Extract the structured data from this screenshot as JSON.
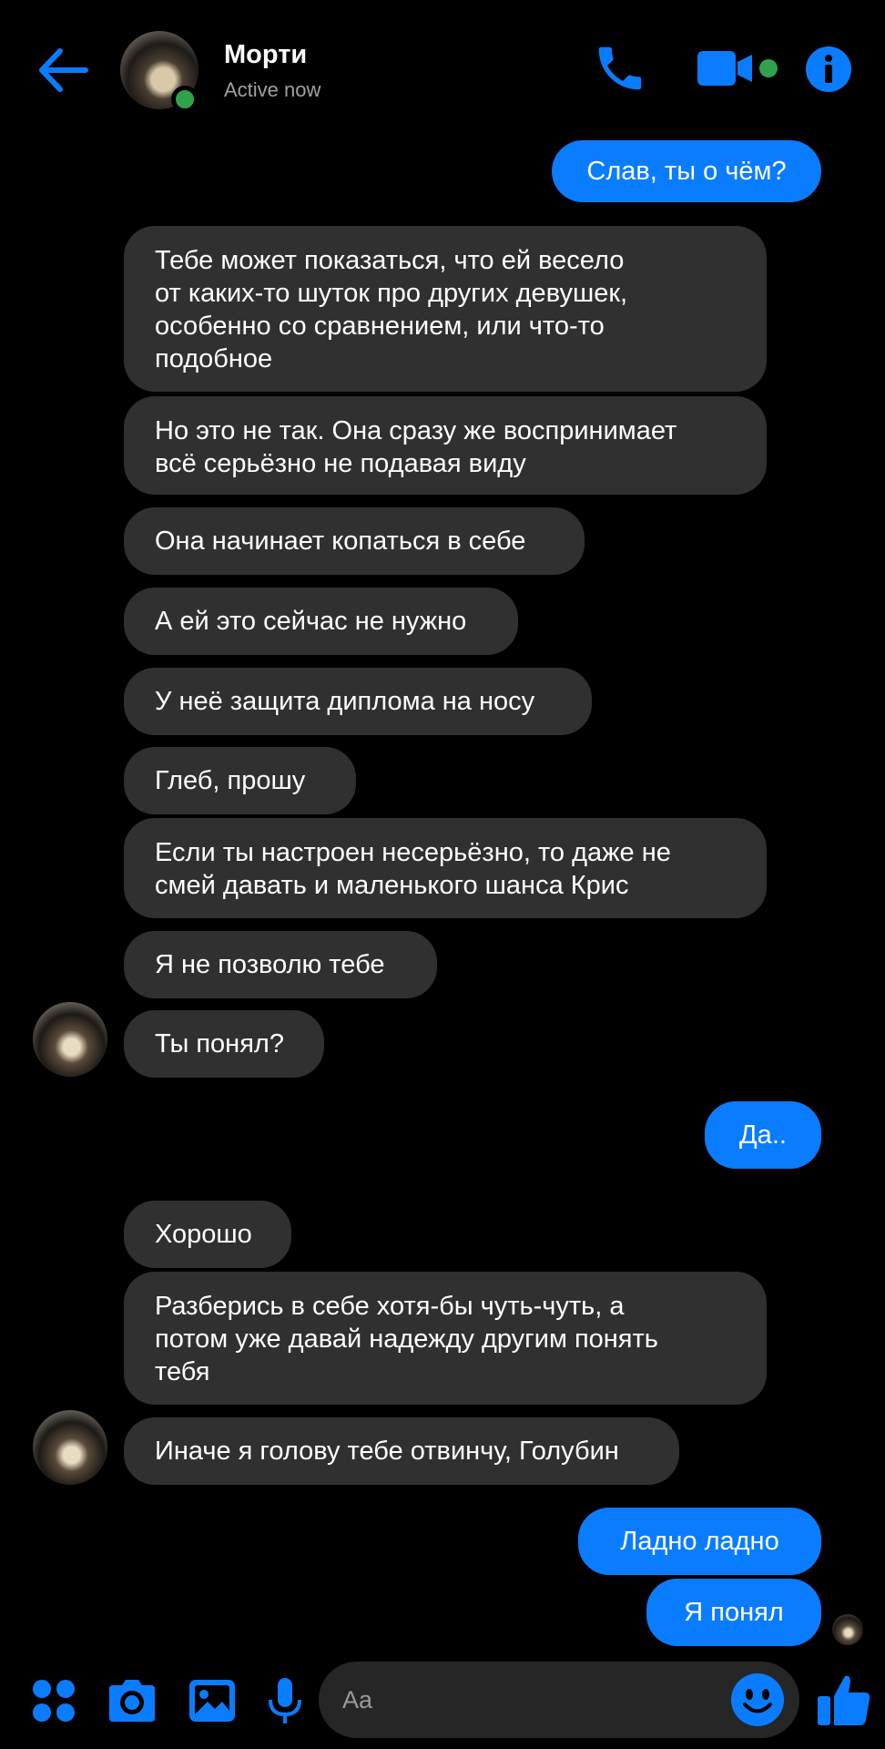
{
  "colors": {
    "background": "#000000",
    "accent": "#0a7cff",
    "incoming_bubble": "#303030",
    "online": "#31a24c"
  },
  "header": {
    "name": "Морти",
    "status": "Active now",
    "icons": [
      "back-arrow-icon",
      "phone-icon",
      "video-camera-icon",
      "info-icon"
    ]
  },
  "messages": [
    {
      "dir": "out",
      "text": "Слав, ты о чём?"
    },
    {
      "dir": "in",
      "text": "Тебе может показаться,  что ей весело\nот каких-то шуток про других девушек,\nособенно со сравнением, или что-то\nподобное"
    },
    {
      "dir": "in",
      "text": "Но это не так. Она сразу же воспринимает\nвсё серьёзно не подавая виду"
    },
    {
      "dir": "in",
      "text": "Она начинает копаться в себе"
    },
    {
      "dir": "in",
      "text": "А ей это сейчас не нужно"
    },
    {
      "dir": "in",
      "text": "У неё защита диплома на носу"
    },
    {
      "dir": "in",
      "text": "Глеб,  прошу"
    },
    {
      "dir": "in",
      "text": "Если ты настроен несерьёзно,  то даже не\nсмей давать и маленького шанса Крис"
    },
    {
      "dir": "in",
      "text": "Я не позволю тебе"
    },
    {
      "dir": "in",
      "text": "Ты понял?"
    },
    {
      "dir": "out",
      "text": "Да.."
    },
    {
      "dir": "in",
      "text": "Хорошо"
    },
    {
      "dir": "in",
      "text": "Разберись в себе хотя-бы чуть-чуть,  а\nпотом уже давай надежду другим понять\nтебя"
    },
    {
      "dir": "in",
      "text": "Иначе я голову тебе отвинчу, Голубин"
    },
    {
      "dir": "out",
      "text": "Ладно  ладно"
    },
    {
      "dir": "out",
      "text": "Я понял"
    }
  ],
  "composer": {
    "placeholder": "Aa",
    "icons": [
      "apps-grid-icon",
      "camera-icon",
      "gallery-icon",
      "microphone-icon",
      "emoji-icon",
      "thumbs-up-icon"
    ]
  }
}
